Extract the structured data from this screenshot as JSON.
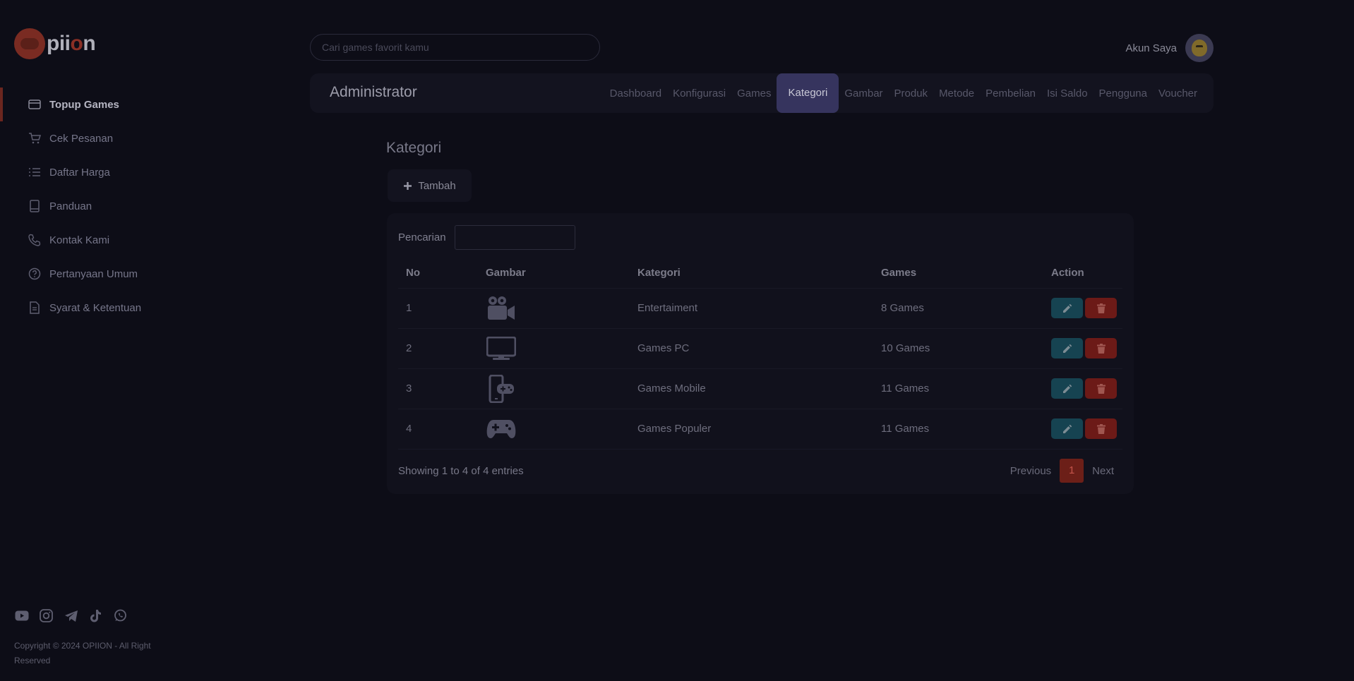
{
  "brand": {
    "name_pre": "pii",
    "name_o": "o",
    "name_post": "n"
  },
  "sidebar": {
    "items": [
      {
        "label": "Topup Games",
        "icon": "card-icon",
        "active": true
      },
      {
        "label": "Cek Pesanan",
        "icon": "cart-icon"
      },
      {
        "label": "Daftar Harga",
        "icon": "list-icon"
      },
      {
        "label": "Panduan",
        "icon": "book-icon"
      },
      {
        "label": "Kontak Kami",
        "icon": "phone-icon"
      },
      {
        "label": "Pertanyaan Umum",
        "icon": "question-icon"
      },
      {
        "label": "Syarat & Ketentuan",
        "icon": "document-icon"
      }
    ],
    "social": [
      "youtube-icon",
      "instagram-icon",
      "telegram-icon",
      "tiktok-icon",
      "whatsapp-icon"
    ],
    "copyright": "Copyright © 2024 OPIION - All Right Reserved"
  },
  "header": {
    "search_placeholder": "Cari games favorit kamu",
    "account_label": "Akun Saya"
  },
  "admin": {
    "title": "Administrator",
    "tabs": [
      "Dashboard",
      "Konfigurasi",
      "Games",
      "Kategori",
      "Gambar",
      "Produk",
      "Metode",
      "Pembelian",
      "Isi Saldo",
      "Pengguna",
      "Voucher"
    ],
    "active_tab": "Kategori"
  },
  "main": {
    "page_title": "Kategori",
    "add_label": "Tambah",
    "search_label": "Pencarian",
    "columns": [
      "No",
      "Gambar",
      "Kategori",
      "Games",
      "Action"
    ],
    "rows": [
      {
        "no": "1",
        "icon": "video-camera-icon",
        "kategori": "Entertaiment",
        "games": "8 Games"
      },
      {
        "no": "2",
        "icon": "desktop-icon",
        "kategori": "Games PC",
        "games": "10 Games"
      },
      {
        "no": "3",
        "icon": "mobile-gamepad-icon",
        "kategori": "Games Mobile",
        "games": "11 Games"
      },
      {
        "no": "4",
        "icon": "gamepad-icon",
        "kategori": "Games Populer",
        "games": "11 Games"
      }
    ],
    "info": "Showing 1 to 4 of 4 entries",
    "pager": {
      "previous": "Previous",
      "current": "1",
      "next": "Next"
    }
  }
}
